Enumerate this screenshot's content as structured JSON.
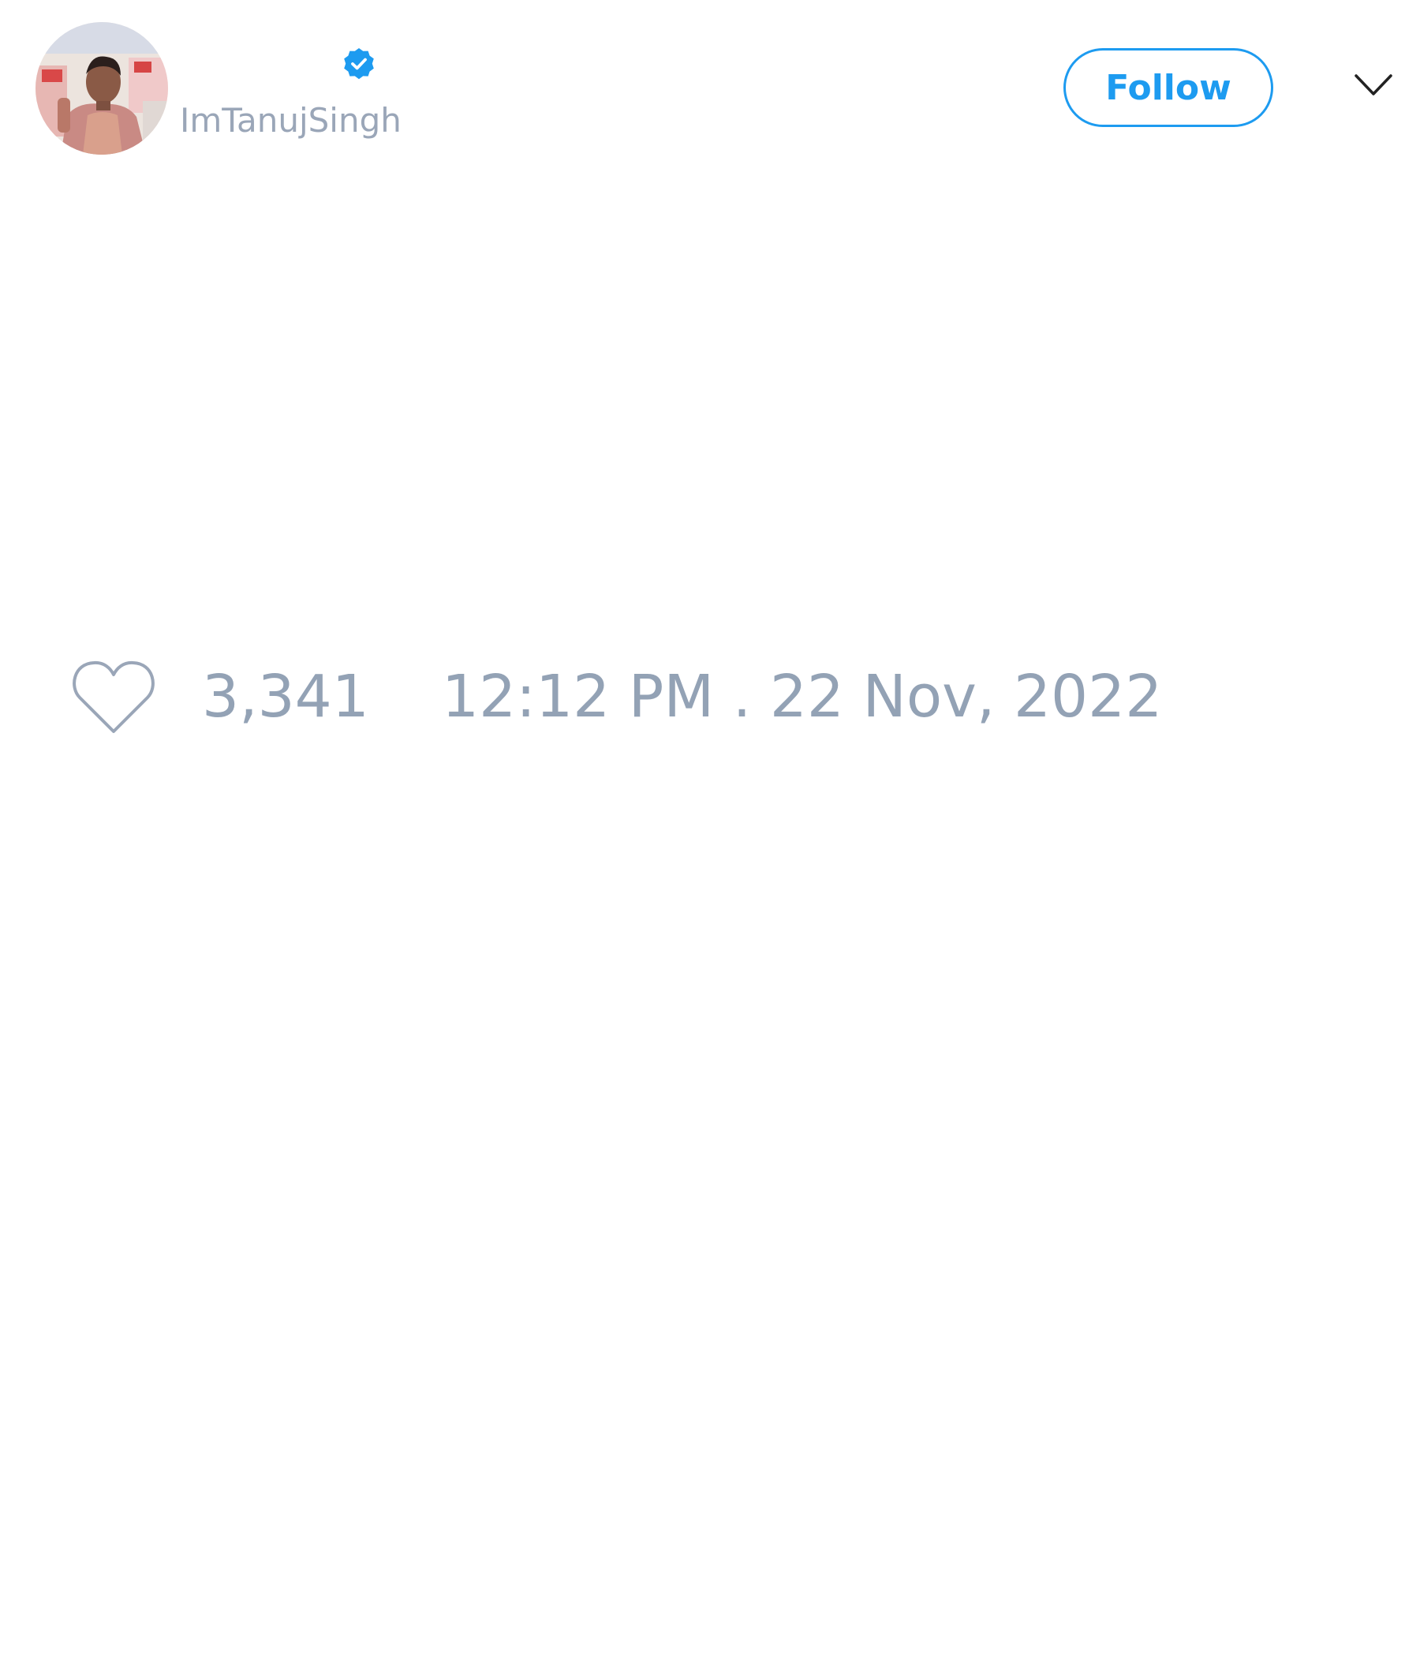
{
  "tweet": {
    "author": {
      "handle": "ImTanujSingh",
      "verified": true,
      "avatar": "profile-photo"
    },
    "follow_label": "Follow",
    "menu_icon": "chevron-down-icon",
    "likes": {
      "icon": "heart-icon",
      "count": "3,341"
    },
    "timestamp": "12:12 PM . 22 Nov, 2022"
  },
  "colors": {
    "accent": "#1d9bf0",
    "muted_text": "#93a2b5",
    "background": "#ffffff"
  }
}
